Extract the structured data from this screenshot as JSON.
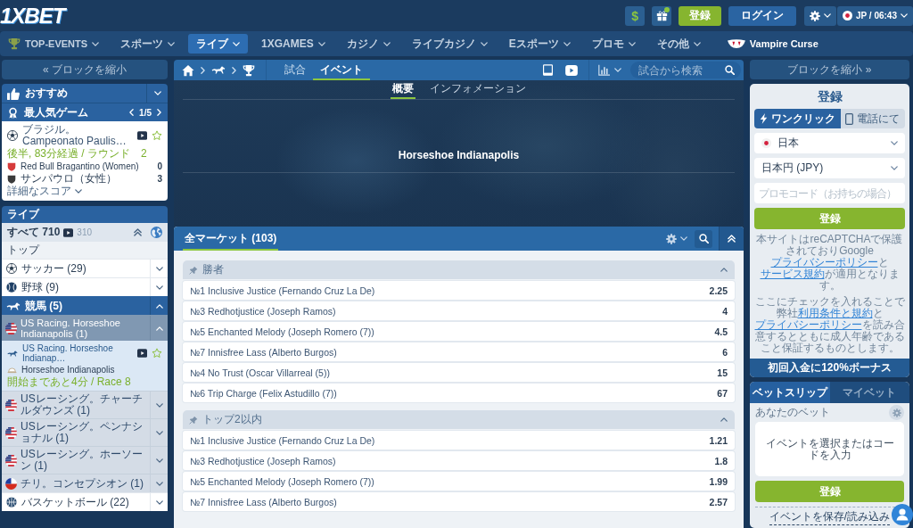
{
  "header": {
    "logo": "1XBET",
    "deposit_symbol": "$",
    "register_button": "登録",
    "login_button": "ログイン",
    "locale": "JP / 06:43"
  },
  "nav": [
    {
      "kind": "featured",
      "label": "TOP-EVENTS",
      "selected": false
    },
    {
      "kind": "menu",
      "label": "スポーツ",
      "selected": false
    },
    {
      "kind": "menu",
      "label": "ライブ",
      "selected": true
    },
    {
      "kind": "menu",
      "label": "1XGAMES",
      "selected": false
    },
    {
      "kind": "menu",
      "label": "カジノ",
      "selected": false
    },
    {
      "kind": "menu",
      "label": "ライブカジノ",
      "selected": false
    },
    {
      "kind": "menu",
      "label": "Eスポーツ",
      "selected": false
    },
    {
      "kind": "menu",
      "label": "プロモ",
      "selected": false
    },
    {
      "kind": "menu",
      "label": "その他",
      "selected": false
    },
    {
      "kind": "promo",
      "label": "Vampire Curse",
      "selected": false
    }
  ],
  "left_sidebar": {
    "collapse_button": "« ブロックを縮小",
    "recommended": {
      "title": "おすすめ"
    },
    "popular": {
      "title": "最人気ゲーム",
      "pager": "1/5",
      "match": {
        "league": "ブラジル。Campeonato Paulis…",
        "status": "後半, 83分経過 / ラウンド　2",
        "teams": [
          {
            "name": "Red Bull Bragantino (Women)",
            "score": "0",
            "color": "#d63b3b"
          },
          {
            "name": "サンパウロ（女性）",
            "score": "3",
            "color": "#3a3a3a"
          }
        ],
        "details_link": "詳細なスコア"
      }
    },
    "live": {
      "title": "ライブ",
      "all_label": "すべて 710",
      "video_count": "310",
      "top_label": "トップ",
      "sports": [
        {
          "kind": "soccer",
          "label": "サッカー (29)",
          "expanded": false
        },
        {
          "kind": "baseball",
          "label": "野球 (9)",
          "expanded": false
        },
        {
          "kind": "horse-racing",
          "label": "競馬 (5)",
          "expanded": true,
          "children": [
            {
              "kind": "usa",
              "label": "US Racing. Horseshoe Indianapolis (1)",
              "expanded": true,
              "events": [
                {
                  "league": "US Racing. Horseshoe Indianap…",
                  "name": "Horseshoe Indianapolis",
                  "status": "開始まであと4分 / Race 8"
                }
              ]
            },
            {
              "kind": "usa",
              "label": "USレーシング。チャーチルダウンズ (1)",
              "expanded": false
            },
            {
              "kind": "usa",
              "label": "USレーシング。ペンナショナル (1)",
              "expanded": false
            },
            {
              "kind": "usa",
              "label": "USレーシング。ホーソーン (1)",
              "expanded": false
            },
            {
              "kind": "chile",
              "label": "チリ。コンセプシオン (1)",
              "expanded": false
            }
          ]
        },
        {
          "kind": "basketball",
          "label": "バスケットボール (22)",
          "expanded": false
        }
      ]
    }
  },
  "event_bar": {
    "tabs": [
      {
        "label": "試合",
        "selected": false
      },
      {
        "label": "イベント",
        "selected": true
      }
    ],
    "search": {
      "placeholder": "試合から検索"
    }
  },
  "event_banner": {
    "tabs": [
      {
        "label": "概要",
        "selected": true
      },
      {
        "label": "インフォメーション",
        "selected": false
      }
    ],
    "title": "Horseshoe Indianapolis"
  },
  "markets": {
    "title": "全マーケット (103)",
    "groups": [
      {
        "title": "勝者",
        "expanded": true,
        "outcomes": [
          {
            "name": "№1 Inclusive Justice (Fernando Cruz La De)",
            "odds": "2.25"
          },
          {
            "name": "№3 Redhotjustice (Joseph Ramos)",
            "odds": "4"
          },
          {
            "name": "№5 Enchanted Melody (Joseph Romero (7))",
            "odds": "4.5"
          },
          {
            "name": "№7 Innisfree Lass (Alberto Burgos)",
            "odds": "6"
          },
          {
            "name": "№4 No Trust (Oscar Villarreal (5))",
            "odds": "15"
          },
          {
            "name": "№6 Trip Charge (Felix Astudillo (7))",
            "odds": "67"
          }
        ]
      },
      {
        "title": "トップ2以内",
        "expanded": true,
        "outcomes": [
          {
            "name": "№1 Inclusive Justice (Fernando Cruz La De)",
            "odds": "1.21"
          },
          {
            "name": "№3 Redhotjustice (Joseph Ramos)",
            "odds": "1.8"
          },
          {
            "name": "№5 Enchanted Melody (Joseph Romero (7))",
            "odds": "1.99"
          },
          {
            "name": "№7 Innisfree Lass (Alberto Burgos)",
            "odds": "2.57"
          }
        ]
      }
    ]
  },
  "right_sidebar": {
    "collapse_button": "ブロックを縮小 »",
    "registration": {
      "title": "登録",
      "tabs": [
        {
          "label": "ワンクリック",
          "selected": true
        },
        {
          "label": "電話にて",
          "selected": false
        }
      ],
      "country": "日本",
      "currency": "日本円 (JPY)",
      "promo_code": {
        "placeholder": "プロモコード（お持ちの場合）"
      },
      "submit_button": "登録",
      "notices": [
        {
          "parts": [
            {
              "text": "本サイトはreCAPTCHAで保護されておりGoogle "
            },
            {
              "text": "プライバシーポリシー",
              "link": true
            },
            {
              "text": "と"
            },
            {
              "text": "サービス規約",
              "link": true
            },
            {
              "text": "が適用となります。"
            }
          ]
        },
        {
          "parts": [
            {
              "text": "ここにチェックを入れることで弊社"
            },
            {
              "text": "利用条件と規約",
              "link": true
            },
            {
              "text": "と"
            },
            {
              "text": "プライバシーポリシー",
              "link": true
            },
            {
              "text": "を読み合意するとともに成人年齢であること保証するものとします。"
            }
          ]
        }
      ],
      "bonus": "初回入金に120%ボーナス"
    },
    "bet_slip": {
      "tabs": [
        {
          "label": "ベットスリップ",
          "selected": true
        },
        {
          "label": "マイベット",
          "selected": false
        }
      ],
      "subtitle": "あなたのベット",
      "empty_message": "イベントを選択またはコードを入力",
      "submit_button": "登録",
      "save_link": "イベントを保存/読み込み"
    }
  }
}
